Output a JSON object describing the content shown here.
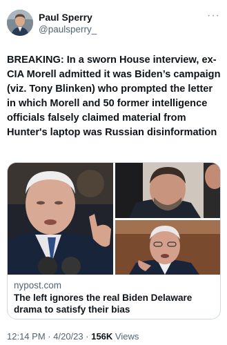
{
  "author": {
    "name": "Paul Sperry",
    "handle": "@paulsperry_"
  },
  "tweet": {
    "text": "BREAKING: In a sworn House interview, ex-CIA Morell admitted it was Biden’s campaign (viz. Tony Blinken) who prompted the letter in which Morell and 50 former intelligence officials falsely claimed material from Hunter's laptop was Russian disinformation"
  },
  "card": {
    "domain": "nypost.com",
    "title": "The left ignores the real Biden Delaware drama to satisfy their bias"
  },
  "meta": {
    "time": "12:14 PM",
    "date": "4/20/23",
    "views_count": "156K",
    "views_label": "Views",
    "separator": "·"
  },
  "icons": {
    "more": "more-horizontal-icon"
  }
}
